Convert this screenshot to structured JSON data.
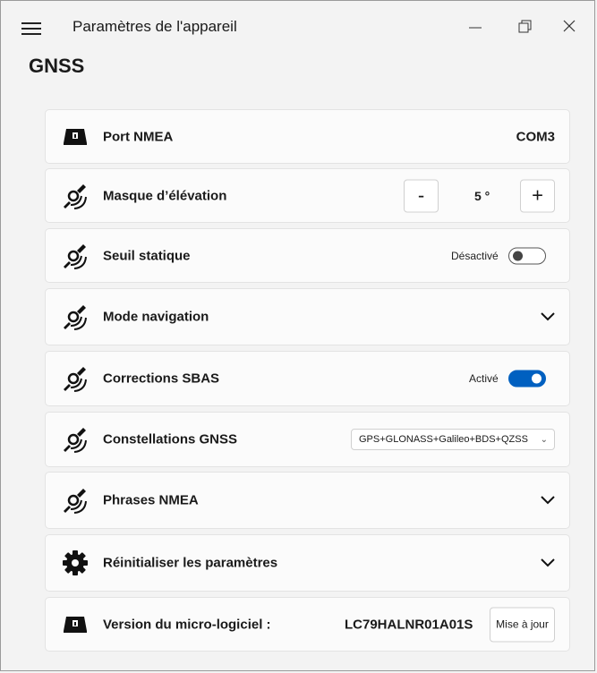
{
  "window": {
    "title": "Paramètres de l'appareil"
  },
  "page": {
    "title": "GNSS"
  },
  "settings": {
    "nmea_port": {
      "label": "Port NMEA",
      "value": "COM3",
      "icon": "device-icon"
    },
    "elevation_mask": {
      "label": "Masque d’élévation",
      "value": "5 °",
      "decrement": "-",
      "increment": "+",
      "icon": "satellite-icon"
    },
    "static_threshold": {
      "label": "Seuil statique",
      "state_label": "Désactivé",
      "enabled": false,
      "icon": "satellite-icon"
    },
    "navigation_mode": {
      "label": "Mode navigation",
      "expanded": false,
      "icon": "satellite-icon"
    },
    "sbas_corrections": {
      "label": "Corrections SBAS",
      "state_label": "Activé",
      "enabled": true,
      "icon": "satellite-icon"
    },
    "gnss_constellations": {
      "label": "Constellations GNSS",
      "selected": "GPS+GLONASS+Galileo+BDS+QZSS",
      "icon": "satellite-icon"
    },
    "nmea_sentences": {
      "label": "Phrases NMEA",
      "expanded": false,
      "icon": "satellite-icon"
    },
    "reset": {
      "label": "Réinitialiser les paramètres",
      "expanded": false,
      "icon": "gear-icon"
    },
    "firmware": {
      "label": "Version du micro-logiciel :",
      "value": "LC79HALNR01A01S",
      "button": "Mise à jour",
      "icon": "device-icon"
    }
  },
  "colors": {
    "accent": "#0060c0",
    "background": "#f3f3f3",
    "card": "#fbfbfb"
  }
}
